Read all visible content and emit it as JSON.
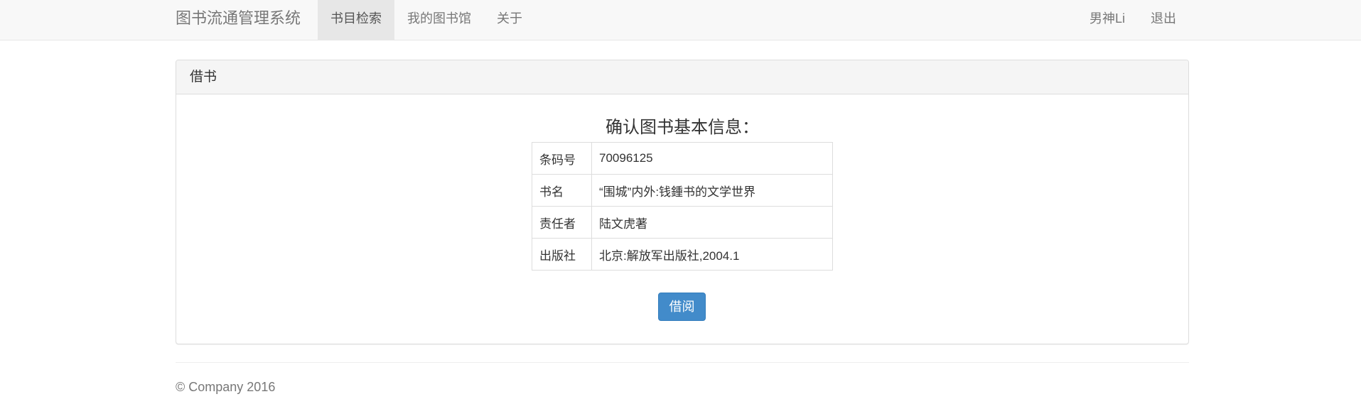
{
  "navbar": {
    "brand": "图书流通管理系统",
    "left_items": [
      {
        "label": "书目检索",
        "active": true
      },
      {
        "label": "我的图书馆",
        "active": false
      },
      {
        "label": "关于",
        "active": false
      }
    ],
    "right_items": [
      {
        "label": "男神Li"
      },
      {
        "label": "退出"
      }
    ]
  },
  "panel": {
    "heading": "借书",
    "confirm_title": "确认图书基本信息：",
    "rows": [
      {
        "label": "条码号",
        "value": "70096125"
      },
      {
        "label": "书名",
        "value": "“围城”内外:钱鍾书的文学世界"
      },
      {
        "label": "责任者",
        "value": "陆文虎著"
      },
      {
        "label": "出版社",
        "value": "北京:解放军出版社,2004.1"
      }
    ],
    "borrow_button": "借阅"
  },
  "footer": {
    "text": "© Company 2016"
  },
  "colors": {
    "navbar_bg": "#f8f8f8",
    "active_nav_bg": "#e7e7e7",
    "primary_button": "#428bca",
    "panel_heading_bg": "#f5f5f5"
  }
}
